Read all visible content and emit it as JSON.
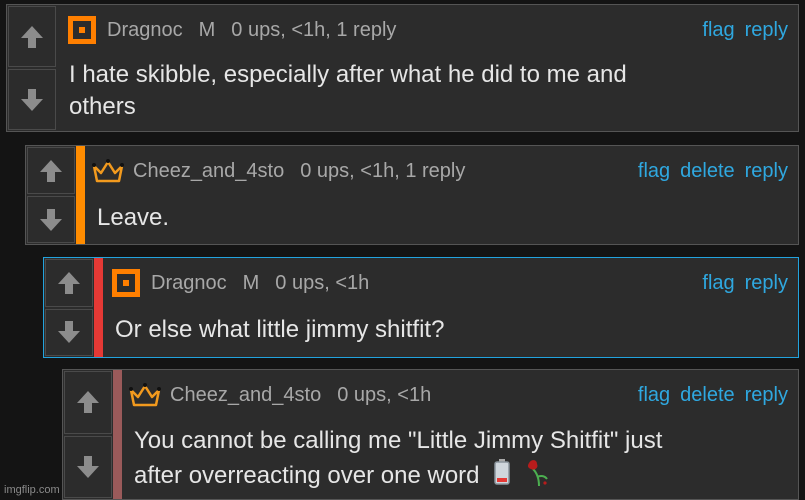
{
  "comments": [
    {
      "username": "Dragnoc",
      "badge": "M",
      "meta": "0 ups, <1h, 1 reply",
      "actions": [
        "flag",
        "reply"
      ],
      "text_lines": [
        "I hate skibble, especially after what he did to me and",
        "others"
      ],
      "avatar": "orange-square-icon",
      "accent_color": null
    },
    {
      "username": "Cheez_and_4sto",
      "badge": "",
      "meta": "0 ups, <1h, 1 reply",
      "actions": [
        "flag",
        "delete",
        "reply"
      ],
      "text_lines": [
        "Leave."
      ],
      "avatar": "crown-icon",
      "accent_color": "#ff8c00"
    },
    {
      "username": "Dragnoc",
      "badge": "M",
      "meta": "0 ups, <1h",
      "actions": [
        "flag",
        "reply"
      ],
      "text_lines": [
        "Or else what little jimmy shitfit?"
      ],
      "avatar": "orange-square-icon",
      "accent_color": "#e53935"
    },
    {
      "username": "Cheez_and_4sto",
      "badge": "",
      "meta": "0 ups, <1h",
      "actions": [
        "flag",
        "delete",
        "reply"
      ],
      "text_lines": [
        "You cannot be calling me \"Little Jimmy Shitfit\" just",
        "after overreacting over one word"
      ],
      "emojis": [
        "🪫",
        "🥀"
      ],
      "avatar": "crown-icon",
      "accent_color": "#9a5a5a"
    }
  ],
  "watermark": "imgflip.com",
  "colors": {
    "link": "#2fa8e0",
    "text": "#e6e6e6",
    "meta": "#a8a8a8",
    "highlight_border": "#22a3de"
  }
}
